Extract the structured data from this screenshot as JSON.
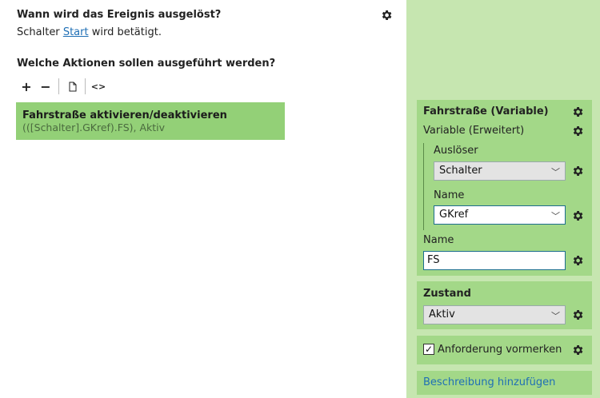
{
  "trigger": {
    "question": "Wann wird das Ereignis ausgelöst?",
    "prefix": "Schalter",
    "link": "Start",
    "suffix": "wird betätigt."
  },
  "actions": {
    "question": "Welche Aktionen sollen ausgeführt werden?",
    "toolbar": {
      "add": "+",
      "remove": "−",
      "copy_icon": "copy-icon",
      "code": "<>"
    },
    "items": [
      {
        "title": "Fahrstraße aktivieren/deaktivieren",
        "subtitle": "(([Schalter].GKref).FS), Aktiv"
      }
    ]
  },
  "properties": {
    "route": {
      "header": "Fahrstraße (Variable)",
      "mode": "Variable (Erweitert)",
      "trigger_label": "Auslöser",
      "trigger_value": "Schalter",
      "name_label": "Name",
      "name_value": "GKref",
      "outer_name_label": "Name",
      "outer_name_value": "FS"
    },
    "state": {
      "header": "Zustand",
      "value": "Aktiv"
    },
    "reserve": {
      "label": "Anforderung vormerken",
      "checked": true,
      "check_glyph": "✓"
    },
    "description_link": "Beschreibung hinzufügen"
  },
  "colors": {
    "panel_bg": "#c6e6b0",
    "panel_box": "#a3d888",
    "action_bg": "#93d077",
    "link": "#1f6fb5"
  },
  "icons": {
    "settings": "gear-icon",
    "dropdown": "chevron-down-icon"
  }
}
